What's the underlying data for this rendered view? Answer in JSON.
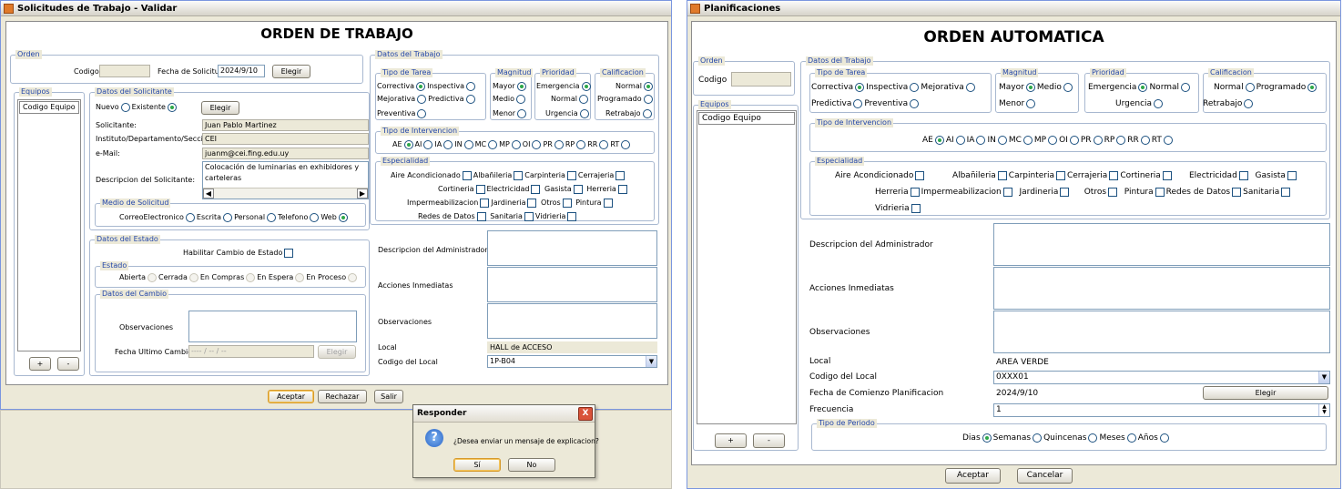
{
  "left": {
    "title": "Solicitudes de Trabajo - Validar",
    "header": "ORDEN DE TRABAJO",
    "orden": {
      "legend": "Orden",
      "codigo_label": "Codigo",
      "codigo_value": "",
      "fecha_label": "Fecha de Solicitud",
      "fecha_value": "2024/9/10",
      "elegir": "Elegir"
    },
    "equipos": {
      "legend": "Equipos",
      "item": "Codigo Equipo",
      "add": "+",
      "remove": "-"
    },
    "solicitante": {
      "legend": "Datos del Solicitante",
      "nuevo": "Nuevo",
      "existente": "Existente",
      "elegir": "Elegir",
      "fields": [
        {
          "label": "Solicitante:",
          "value": "Juan Pablo Martinez"
        },
        {
          "label": "Instituto/Departamento/Seccion:",
          "value": "CEI"
        },
        {
          "label": "e-Mail:",
          "value": "juanm@cei.fing.edu.uy"
        }
      ],
      "desc_label": "Descripcion del Solicitante:",
      "desc_value": "Colocación de luminarias en exhibidores y carteleras"
    },
    "medio": {
      "legend": "Medio de Solicitud",
      "options": [
        "CorreoElectronico",
        "Escrita",
        "Personal",
        "Telefono",
        "Web"
      ],
      "selected": 4
    },
    "estado_datos": {
      "legend": "Datos del Estado",
      "habilitar": "Habilitar Cambio de Estado"
    },
    "estado": {
      "legend": "Estado",
      "options": [
        "Abierta",
        "Cerrada",
        "En Compras",
        "En Espera",
        "En Proceso"
      ]
    },
    "cambio": {
      "legend": "Datos del Cambio",
      "obs_label": "Observaciones",
      "fecha_label": "Fecha Ultimo Cambio",
      "fecha_value": "---- / -- / --",
      "elegir": "Elegir"
    },
    "trabajo": {
      "legend": "Datos del Trabajo",
      "tipo_tarea": {
        "legend": "Tipo de Tarea",
        "options": [
          "Correctiva",
          "Inspectiva",
          "Mejorativa",
          "Predictiva",
          "Preventiva"
        ],
        "selected": 1
      },
      "magnitud": {
        "legend": "Magnitud",
        "options": [
          "Mayor",
          "Medio",
          "Menor"
        ],
        "selected": 0
      },
      "prioridad": {
        "legend": "Prioridad",
        "options": [
          "Emergencia",
          "Normal",
          "Urgencia"
        ],
        "selected": 0
      },
      "calificacion": {
        "legend": "Calificacion",
        "options": [
          "Normal",
          "Programado",
          "Retrabajo"
        ],
        "selected": 0
      },
      "intervencion": {
        "legend": "Tipo de Intervencion",
        "options": [
          "AE",
          "AI",
          "IA",
          "IN",
          "MC",
          "MP",
          "OI",
          "PR",
          "RP",
          "RR",
          "RT"
        ],
        "selected": 0
      },
      "especialidad": {
        "legend": "Especialidad",
        "options": [
          "Aire Acondicionado",
          "Albañileria",
          "Carpinteria",
          "Cerrajeria",
          "Cortineria",
          "Electricidad",
          "Gasista",
          "Herreria",
          "Impermeabilizacion",
          "Jardineria",
          "Otros",
          "Pintura",
          "Redes de Datos",
          "Sanitaria",
          "Vidrieria"
        ]
      }
    },
    "admin_label": "Descripcion del Administrador",
    "acciones_label": "Acciones Inmediatas",
    "obs_label": "Observaciones",
    "local_label": "Local",
    "local_value": "HALL de ACCESO",
    "codlocal_label": "Codigo del Local",
    "codlocal_value": "1P-B04",
    "buttons": {
      "aceptar": "Aceptar",
      "rechazar": "Rechazar",
      "salir": "Salir"
    },
    "dialog": {
      "title": "Responder",
      "message": "¿Desea enviar un mensaje de explicacion?",
      "yes": "Sí",
      "no": "No",
      "close": "X"
    }
  },
  "right": {
    "title": "Planificaciones",
    "header": "ORDEN AUTOMATICA",
    "orden": {
      "legend": "Orden",
      "codigo_label": "Codigo"
    },
    "equipos": {
      "legend": "Equipos",
      "item": "Codigo Equipo",
      "add": "+",
      "remove": "-"
    },
    "trabajo": {
      "legend": "Datos del Trabajo",
      "tipo_tarea": {
        "legend": "Tipo de Tarea",
        "options": [
          "Correctiva",
          "Inspectiva",
          "Mejorativa",
          "Predictiva",
          "Preventiva"
        ],
        "selected": 0
      },
      "magnitud": {
        "legend": "Magnitud",
        "options": [
          "Mayor",
          "Medio",
          "Menor"
        ],
        "selected": 0
      },
      "prioridad": {
        "legend": "Prioridad",
        "options": [
          "Emergencia",
          "Normal",
          "Urgencia"
        ],
        "selected": 0
      },
      "calificacion": {
        "legend": "Calificacion",
        "options": [
          "Normal",
          "Programado",
          "Retrabajo"
        ],
        "selected": 1
      },
      "intervencion": {
        "legend": "Tipo de Intervencion",
        "options": [
          "AE",
          "AI",
          "IA",
          "IN",
          "MC",
          "MP",
          "OI",
          "PR",
          "RP",
          "RR",
          "RT"
        ],
        "selected": 0
      },
      "especialidad": {
        "legend": "Especialidad",
        "options": [
          "Aire Acondicionado",
          "Albañileria",
          "Carpinteria",
          "Cerrajeria",
          "Cortineria",
          "Electricidad",
          "Gasista",
          "Herreria",
          "Impermeabilizacion",
          "Jardineria",
          "Otros",
          "Pintura",
          "Redes de Datos",
          "Sanitaria",
          "Vidrieria"
        ]
      }
    },
    "admin_label": "Descripcion del Administrador",
    "acciones_label": "Acciones Inmediatas",
    "obs_label": "Observaciones",
    "local_label": "Local",
    "local_value": "AREA VERDE",
    "codlocal_label": "Codigo del Local",
    "codlocal_value": "0XXX01",
    "fecha_label": "Fecha de Comienzo Planificacion",
    "fecha_value": "2024/9/10",
    "elegir": "Elegir",
    "frecuencia_label": "Frecuencia",
    "frecuencia_value": "1",
    "periodo": {
      "legend": "Tipo de Periodo",
      "options": [
        "Dias",
        "Semanas",
        "Quincenas",
        "Meses",
        "Años"
      ],
      "selected": 0
    },
    "buttons": {
      "aceptar": "Aceptar",
      "cancelar": "Cancelar"
    }
  },
  "colors": {
    "legend": "#2447a8",
    "radio_on": "#2da84a",
    "dialog_title": "#e8e4d6"
  },
  "icons": [
    "java-app-icon",
    "question-icon",
    "close-icon",
    "chevron-down-icon",
    "spinner-icon"
  ]
}
